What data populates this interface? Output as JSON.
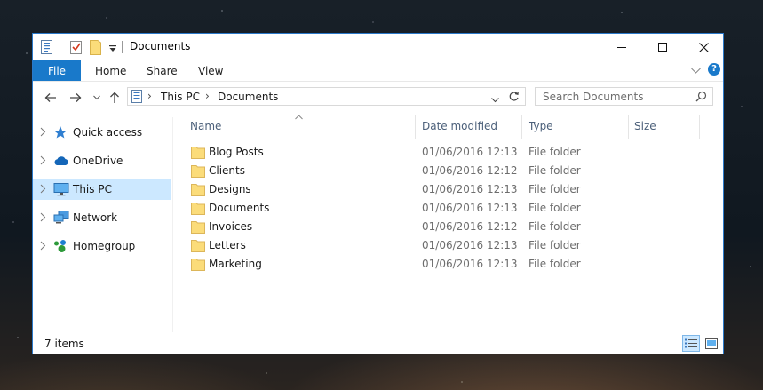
{
  "window": {
    "title": "Documents",
    "controls": {
      "minimize_icon": "minimize-icon",
      "maximize_icon": "maximize-icon",
      "close_icon": "close-icon"
    },
    "accent_color": "#1979ca"
  },
  "quick_access_toolbar": {
    "icons": [
      "properties-icon",
      "checkmark-icon",
      "new-folder-icon",
      "customize-dropdown-icon"
    ]
  },
  "ribbon": {
    "tabs": [
      {
        "label": "File",
        "active": true
      },
      {
        "label": "Home"
      },
      {
        "label": "Share"
      },
      {
        "label": "View"
      }
    ],
    "expand_icon": "chevron-down-icon",
    "help_label": "?"
  },
  "navigation": {
    "back_icon": "arrow-left-icon",
    "forward_icon": "arrow-right-icon",
    "recent_icon": "chevron-down-icon",
    "up_icon": "arrow-up-icon",
    "breadcrumb": [
      "This PC",
      "Documents"
    ],
    "refresh_icon": "refresh-icon",
    "search_placeholder": "Search Documents"
  },
  "sidebar": {
    "items": [
      {
        "label": "Quick access",
        "icon": "star-icon",
        "selected": false
      },
      {
        "label": "OneDrive",
        "icon": "cloud-icon",
        "selected": false
      },
      {
        "label": "This PC",
        "icon": "monitor-icon",
        "selected": true
      },
      {
        "label": "Network",
        "icon": "network-icon",
        "selected": false
      },
      {
        "label": "Homegroup",
        "icon": "homegroup-icon",
        "selected": false
      }
    ]
  },
  "file_list": {
    "columns": [
      "Name",
      "Date modified",
      "Type",
      "Size"
    ],
    "rows": [
      {
        "name": "Blog Posts",
        "date": "01/06/2016 12:13",
        "type": "File folder"
      },
      {
        "name": "Clients",
        "date": "01/06/2016 12:12",
        "type": "File folder"
      },
      {
        "name": "Designs",
        "date": "01/06/2016 12:13",
        "type": "File folder"
      },
      {
        "name": "Documents",
        "date": "01/06/2016 12:13",
        "type": "File folder"
      },
      {
        "name": "Invoices",
        "date": "01/06/2016 12:12",
        "type": "File folder"
      },
      {
        "name": "Letters",
        "date": "01/06/2016 12:13",
        "type": "File folder"
      },
      {
        "name": "Marketing",
        "date": "01/06/2016 12:13",
        "type": "File folder"
      }
    ]
  },
  "status": {
    "item_count": "7 items",
    "views": [
      "details-view-icon",
      "large-icons-view-icon"
    ]
  }
}
